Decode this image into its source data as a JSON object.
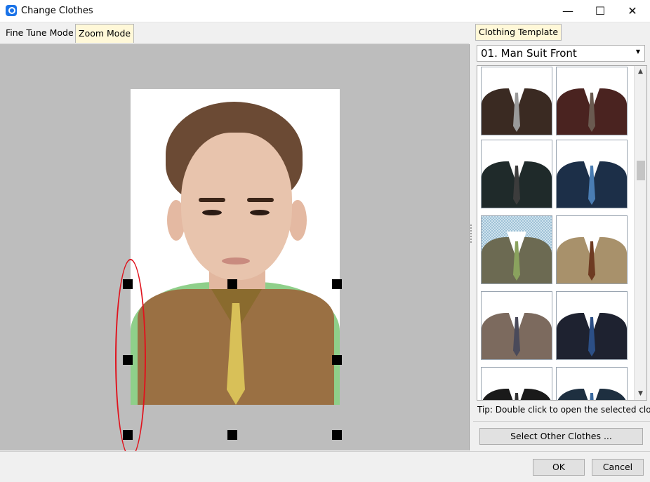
{
  "window": {
    "title": "Change Clothes",
    "minimize": "—",
    "maximize": "☐",
    "close": "✕"
  },
  "left_tabs": [
    {
      "label": "Fine Tune Mode"
    },
    {
      "label": "Zoom Mode"
    }
  ],
  "right_panel": {
    "tab_label": "Clothing Template",
    "dropdown_value": "01. Man Suit Front",
    "tip": "Tip: Double click to open the selected cloth",
    "select_other_label": "Select Other Clothes ...",
    "thumbnails": [
      {
        "jacket_color": "#3a2a22",
        "tie_color": "#9a9a9a"
      },
      {
        "jacket_color": "#4a2320",
        "tie_color": "#6a5a50"
      },
      {
        "jacket_color": "#1f2a2a",
        "tie_color": "#3c3c3c"
      },
      {
        "jacket_color": "#1c2f48",
        "tie_color": "#4a7db3"
      },
      {
        "jacket_color": "#6c6a52",
        "tie_color": "#8aa25e"
      },
      {
        "jacket_color": "#a8916b",
        "tie_color": "#6e3b22"
      },
      {
        "jacket_color": "#7c6a5e",
        "tie_color": "#4a4a5a"
      },
      {
        "jacket_color": "#1e2230",
        "tie_color": "#2c4f86"
      },
      {
        "jacket_color": "#1a1a1a",
        "tie_color": "#333333"
      },
      {
        "jacket_color": "#1e2f40",
        "tie_color": "#3b6aa0"
      }
    ]
  },
  "buttons": {
    "ok": "OK",
    "cancel": "Cancel"
  },
  "colors": {
    "selection_ellipse": "#e0141e",
    "active_tab": "#fff8d8",
    "canvas_bg": "#bdbdbd"
  }
}
